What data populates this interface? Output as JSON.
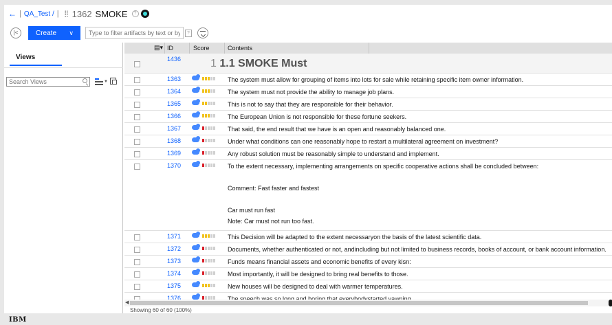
{
  "header": {
    "back_icon": "arrow-left-icon",
    "project": "QA_Test /",
    "artifact_id": "1362",
    "artifact_name": "SMOKE"
  },
  "toolbar": {
    "create_label": "Create",
    "filter_placeholder": "Type to filter artifacts by text or by ID"
  },
  "left_panel": {
    "tab_label": "Views",
    "search_placeholder": "Search Views"
  },
  "grid": {
    "columns": [
      "ID",
      "Score",
      "Contents"
    ],
    "heading_row": {
      "id": "1436",
      "number": "1",
      "title": "1.1 SMOKE Must"
    },
    "rows": [
      {
        "id": "1363",
        "score_level": 3,
        "score_color": "#f1c21b",
        "contents": [
          "The system must allow for grouping of items into lots for sale while retaining specific item owner information."
        ]
      },
      {
        "id": "1364",
        "score_level": 3,
        "score_color": "#f1c21b",
        "contents": [
          "The system must not provide the ability to manage job plans."
        ]
      },
      {
        "id": "1365",
        "score_level": 2,
        "score_color": "#f1c21b",
        "contents": [
          "This is not to say that they are responsible for their behavior."
        ]
      },
      {
        "id": "1366",
        "score_level": 3,
        "score_color": "#f1c21b",
        "contents": [
          "The European Union is not responsible for these fortune seekers."
        ]
      },
      {
        "id": "1367",
        "score_level": 1,
        "score_color": "#da1e28",
        "contents": [
          "That said, the end result that we have is an open and reasonably balanced one."
        ]
      },
      {
        "id": "1368",
        "score_level": 1,
        "score_color": "#da1e28",
        "contents": [
          "Under what conditions can one reasonably hope to restart a multilateral agreement on investment?"
        ]
      },
      {
        "id": "1369",
        "score_level": 1,
        "score_color": "#da1e28",
        "contents": [
          "Any robust solution must be reasonably simple to understand and implement."
        ]
      },
      {
        "id": "1370",
        "score_level": 1,
        "score_color": "#da1e28",
        "contents": [
          "To the extent necessary, implementing arrangements on specific cooperative actions shall be concluded between:",
          "",
          "Comment: Fast faster and fastest",
          "",
          "Car must run fast",
          "Note: Car must not run too fast."
        ]
      },
      {
        "id": "1371",
        "score_level": 3,
        "score_color": "#f1c21b",
        "contents": [
          "This Decision will be adapted to the extent necessaryon the basis of the latest scientific data."
        ]
      },
      {
        "id": "1372",
        "score_level": 1,
        "score_color": "#da1e28",
        "contents": [
          "Documents, whether authenticated or not, andincluding but not limited to business records, books of account, or bank account information."
        ]
      },
      {
        "id": "1373",
        "score_level": 1,
        "score_color": "#da1e28",
        "contents": [
          "Funds means financial assets and economic benefits of every kisn:"
        ]
      },
      {
        "id": "1374",
        "score_level": 1,
        "score_color": "#da1e28",
        "contents": [
          "Most importantly, it will be designed to bring real benefits to those."
        ]
      },
      {
        "id": "1375",
        "score_level": 3,
        "score_color": "#f1c21b",
        "contents": [
          "New houses will be designed to deal with warmer temperatures."
        ]
      },
      {
        "id": "1376",
        "score_level": 1,
        "score_color": "#da1e28",
        "contents": [
          "The speech was so long and boring that everybodystarted yawning."
        ]
      }
    ],
    "status": "Showing 60 of 60 (100%)"
  },
  "footer": {
    "brand": "IBM"
  }
}
